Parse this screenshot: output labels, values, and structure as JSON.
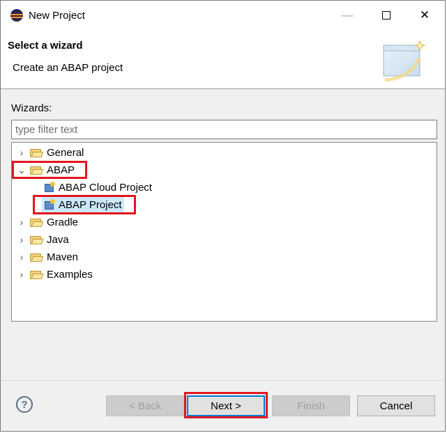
{
  "window": {
    "title": "New Project"
  },
  "header": {
    "title": "Select a wizard",
    "description": "Create an ABAP project"
  },
  "wizards_label": "Wizards:",
  "filter": {
    "value": "",
    "placeholder": "type filter text"
  },
  "tree": [
    {
      "label": "General",
      "type": "folder",
      "expanded": false
    },
    {
      "label": "ABAP",
      "type": "folder",
      "expanded": true,
      "highlighted": true
    },
    {
      "label": "ABAP Cloud Project",
      "type": "project"
    },
    {
      "label": "ABAP Project",
      "type": "project",
      "selected": true,
      "highlighted": true
    },
    {
      "label": "Gradle",
      "type": "folder",
      "expanded": false
    },
    {
      "label": "Java",
      "type": "folder",
      "expanded": false
    },
    {
      "label": "Maven",
      "type": "folder",
      "expanded": false
    },
    {
      "label": "Examples",
      "type": "folder",
      "expanded": false
    }
  ],
  "buttons": {
    "back": "< Back",
    "next": "Next >",
    "finish": "Finish",
    "cancel": "Cancel",
    "help": "?"
  },
  "colors": {
    "highlight": "#e2161d",
    "selection": "#cce8ff",
    "default_button_border": "#0078d7"
  },
  "icons": {
    "app": "eclipse-icon",
    "collapsed": "chevron-right-icon",
    "expanded": "chevron-down-icon",
    "folder": "folder-icon",
    "project": "abap-project-icon",
    "help": "help-icon"
  }
}
